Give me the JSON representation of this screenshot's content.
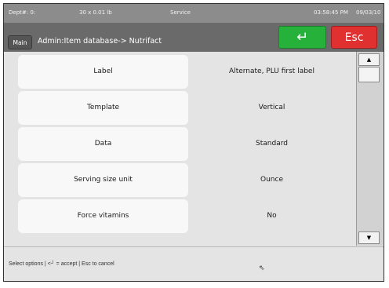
{
  "status": {
    "dept": "Dept#: 0:",
    "weight": "30 x 0.01 lb",
    "mode": "Service",
    "time": "03:58:45 PM",
    "date": "09/03/10"
  },
  "header": {
    "main_label": "Main",
    "title": "Admin:Item database-> Nutrifact",
    "enter_symbol": "↵",
    "esc_label": "Esc"
  },
  "rows": [
    {
      "label": "Label",
      "value": "Alternate, PLU first label"
    },
    {
      "label": "Template",
      "value": "Vertical"
    },
    {
      "label": "Data",
      "value": "Standard"
    },
    {
      "label": "Serving size unit",
      "value": "Ounce"
    },
    {
      "label": "Force vitamins",
      "value": "No"
    }
  ],
  "scrollbar": {
    "up_arrow": "▲",
    "down_arrow": "▼"
  },
  "footer": {
    "hint": "Select options | <┘ = accept | Esc to cancel"
  },
  "colors": {
    "accept": "#26b13a",
    "escape": "#e03030",
    "titlebar": "#6a6a6a",
    "statusbar": "#8c8c8c"
  }
}
